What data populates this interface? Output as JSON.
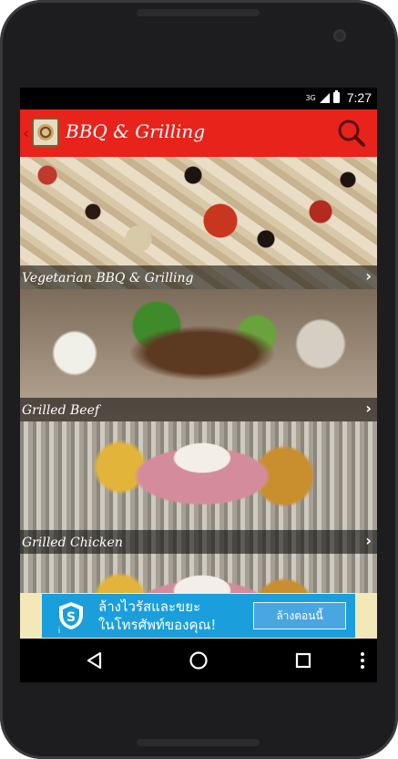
{
  "status_bar": {
    "network": "3G",
    "time": "7:27"
  },
  "app_bar": {
    "title": "BBQ & Grilling",
    "icons": [
      "app-logo-icon",
      "search-icon"
    ]
  },
  "categories": [
    {
      "label": "Vegetarian BBQ & Grilling"
    },
    {
      "label": "Grilled Beef"
    },
    {
      "label": "Grilled Chicken"
    }
  ],
  "ad": {
    "line1": "ล้างไวรัสและขยะ",
    "line2": "ในโทรศัพท์ของคุณ!",
    "button": "ล้างตอนนี้",
    "info": "i"
  },
  "navigation": {
    "icons": [
      "back-triangle-icon",
      "home-circle-icon",
      "recents-square-icon",
      "overflow-menu-icon"
    ]
  },
  "colors": {
    "app_bar": "#e8231c",
    "ad_background": "#1a9fdc",
    "ad_surround": "#f3e9b8"
  }
}
